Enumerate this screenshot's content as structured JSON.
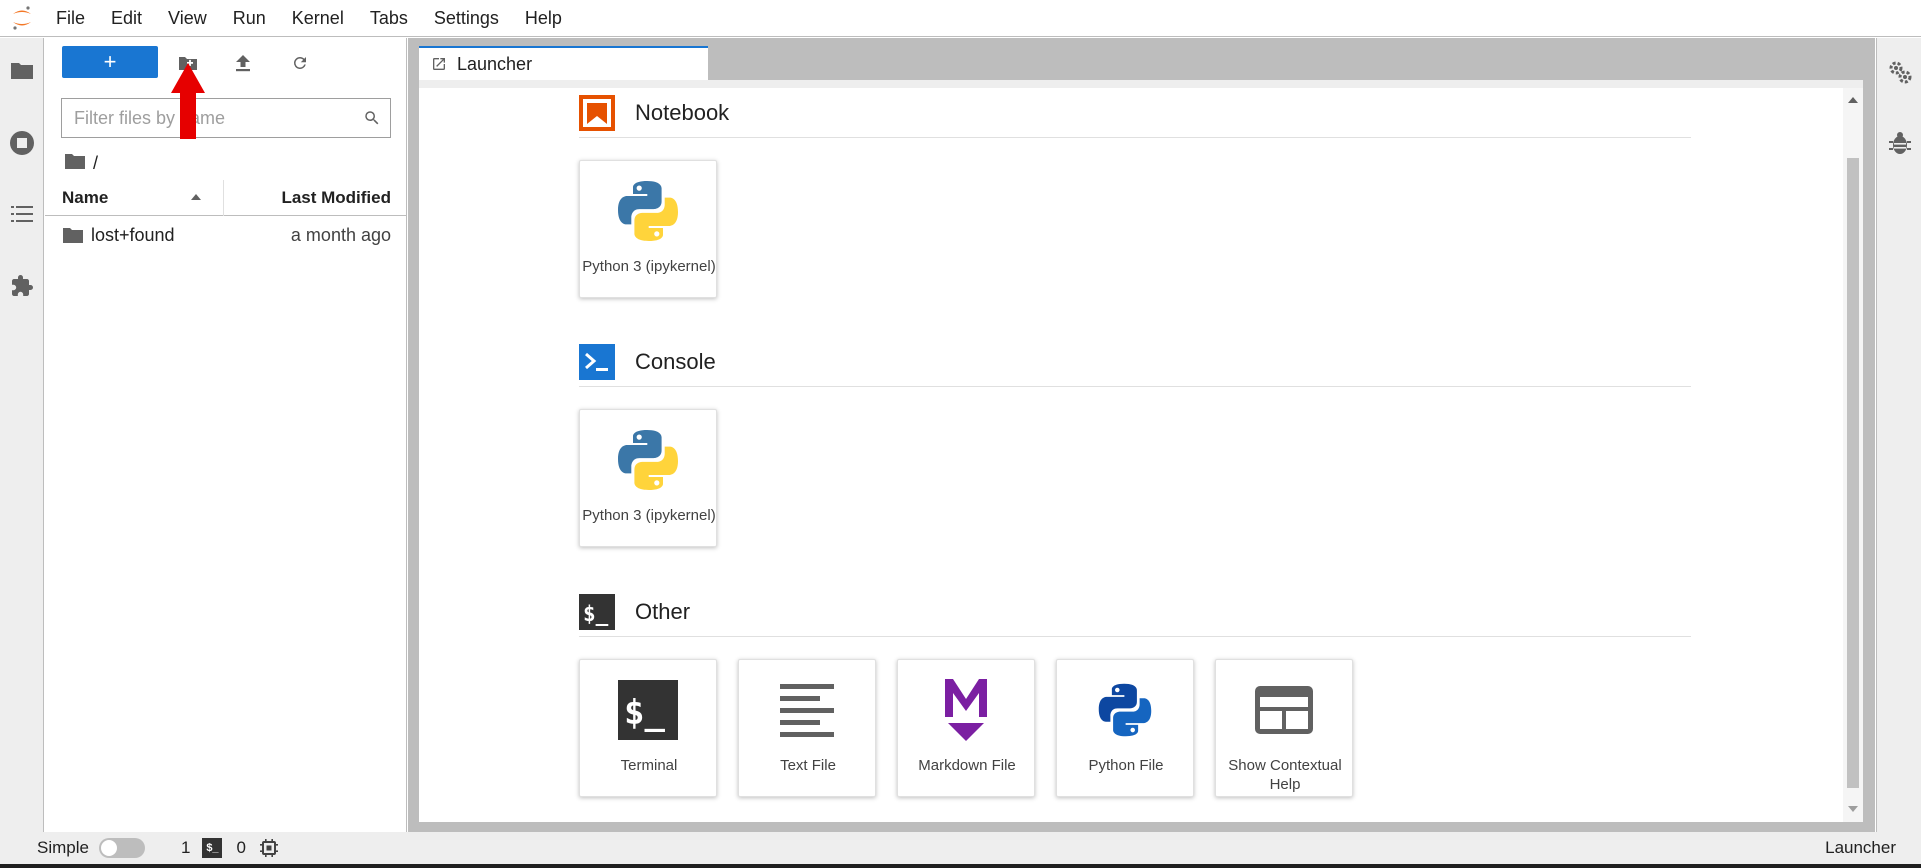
{
  "menubar": {
    "items": [
      "File",
      "Edit",
      "View",
      "Run",
      "Kernel",
      "Tabs",
      "Settings",
      "Help"
    ]
  },
  "leftbar": {
    "icons": [
      "folder-icon",
      "running-icon",
      "toc-icon",
      "extension-icon"
    ]
  },
  "filebrowser": {
    "new_label": "+",
    "filter_placeholder": "Filter files by name",
    "breadcrumb_root": "/",
    "columns": {
      "name": "Name",
      "modified": "Last Modified"
    },
    "rows": [
      {
        "name": "lost+found",
        "modified": "a month ago",
        "type": "folder"
      }
    ]
  },
  "tabs": [
    {
      "label": "Launcher",
      "active": true
    }
  ],
  "launcher": {
    "sections": [
      {
        "title": "Notebook",
        "cards": [
          {
            "label": "Python 3 (ipykernel)"
          }
        ]
      },
      {
        "title": "Console",
        "cards": [
          {
            "label": "Python 3 (ipykernel)"
          }
        ]
      },
      {
        "title": "Other",
        "cards": [
          {
            "label": "Terminal"
          },
          {
            "label": "Text File"
          },
          {
            "label": "Markdown File"
          },
          {
            "label": "Python File"
          },
          {
            "label": "Show Contextual Help"
          }
        ]
      }
    ]
  },
  "statusbar": {
    "simple_label": "Simple",
    "simple_enabled": false,
    "terminal_count": "1",
    "terminal_icon_text": "$_",
    "kernel_count": "0",
    "right_label": "Launcher"
  },
  "colors": {
    "accent": "#1976d2",
    "notebook_icon": "#e65100",
    "markdown_icon": "#7b1fa2",
    "annotation_arrow": "#e60000"
  }
}
